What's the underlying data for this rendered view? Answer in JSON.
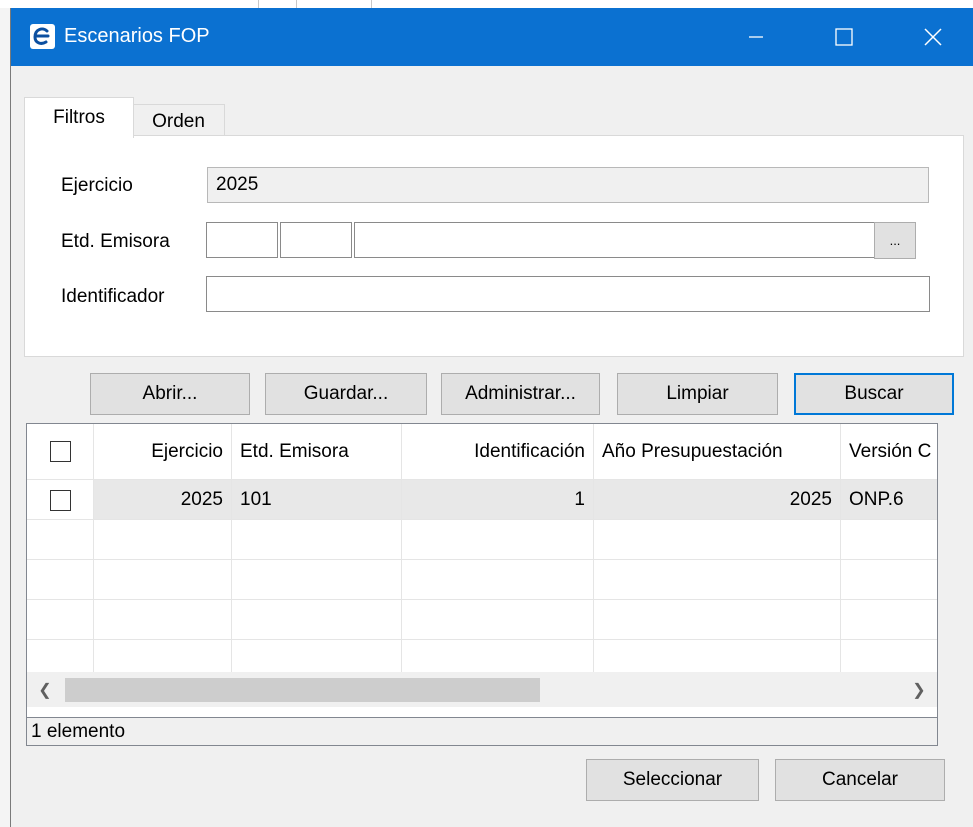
{
  "window": {
    "title": "Escenarios FOP",
    "icon": "app-logo-icon",
    "accent": "#0b71d1"
  },
  "tabs": [
    {
      "label": "Filtros"
    },
    {
      "label": "Orden"
    }
  ],
  "filters": {
    "ejercicio_label": "Ejercicio",
    "ejercicio_value": "2025",
    "emisora_label": "Etd. Emisora",
    "emisora_values": [
      "",
      "",
      ""
    ],
    "emisora_browse": "...",
    "identificador_label": "Identificador",
    "identificador_value": ""
  },
  "actions": {
    "abrir": "Abrir...",
    "guardar": "Guardar...",
    "administrar": "Administrar...",
    "limpiar": "Limpiar",
    "buscar": "Buscar"
  },
  "table": {
    "columns": [
      "Ejercicio",
      "Etd. Emisora",
      "Identificación",
      "Año Presupuestación",
      "Versión C"
    ],
    "rows": [
      {
        "ejercicio": "2025",
        "emisora": "101",
        "identificacion": "1",
        "anio": "2025",
        "version": "ONP.6"
      }
    ]
  },
  "status": "1 elemento",
  "footer": {
    "seleccionar": "Seleccionar",
    "cancelar": "Cancelar"
  }
}
